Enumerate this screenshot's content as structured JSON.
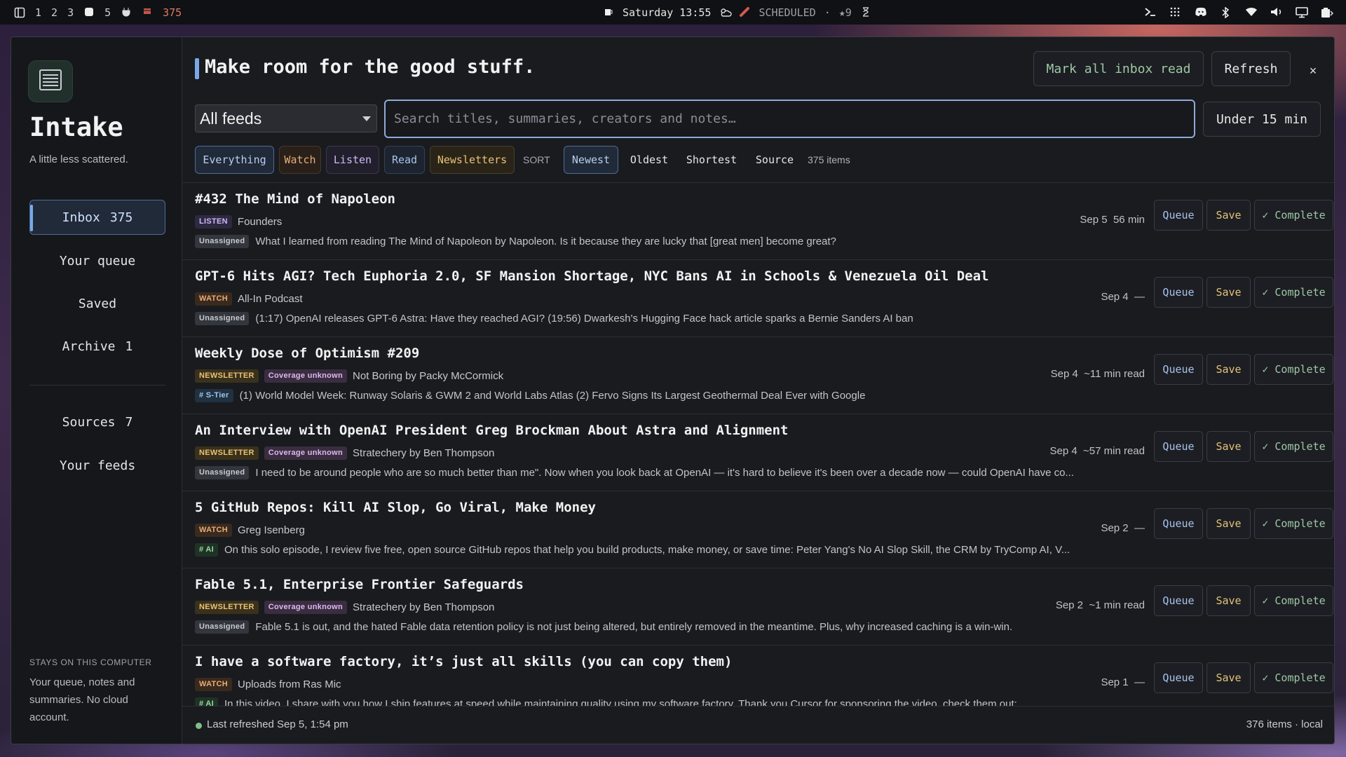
{
  "topbar": {
    "workspaces": [
      "1",
      "2",
      "3",
      "5"
    ],
    "counter_label": "375",
    "datetime": "Saturday 13:55",
    "scheduled_label": "SCHEDULED",
    "separator": "·",
    "stars": "★9"
  },
  "app": {
    "title": "Intake",
    "subtitle": "A little less scattered.",
    "headline": "Make room for the good stuff."
  },
  "sidebar": {
    "items": [
      {
        "label": "Inbox",
        "count": "375"
      },
      {
        "label": "Your queue",
        "count": ""
      },
      {
        "label": "Saved",
        "count": ""
      },
      {
        "label": "Archive",
        "count": "1"
      },
      {
        "label": "Sources",
        "count": "7"
      },
      {
        "label": "Your feeds",
        "count": ""
      }
    ],
    "footer_title": "STAYS ON THIS COMPUTER",
    "footer_text": "Your queue, notes and summaries. No cloud account."
  },
  "header": {
    "mark_all_label": "Mark all inbox read",
    "refresh_label": "Refresh",
    "close_label": "×",
    "feed_select_value": "All feeds",
    "search_placeholder": "Search titles, summaries, creators and notes…",
    "duration_filter": "Under 15 min"
  },
  "filters": {
    "chips": [
      "Everything",
      "Watch",
      "Listen",
      "Read",
      "Newsletters"
    ],
    "sort_label": "SORT",
    "sort_options": [
      "Newest",
      "Oldest",
      "Shortest",
      "Source"
    ],
    "item_count": "375 items"
  },
  "item_buttons": {
    "queue": "Queue",
    "save": "Save",
    "complete": "✓ Complete"
  },
  "items": [
    {
      "title": "#432 The Mind of Napoleon",
      "type": "LISTEN",
      "coverage": "",
      "source": "Founders",
      "tag": "Unassigned",
      "summary": "What I learned from reading The Mind of Napoleon by Napoleon. Is it because they are lucky that [great men] become great?",
      "date": "Sep 5",
      "duration": "56 min"
    },
    {
      "title": "GPT-6 Hits AGI? Tech Euphoria 2.0, SF Mansion Shortage, NYC Bans AI in Schools & Venezuela Oil Deal",
      "type": "WATCH",
      "coverage": "",
      "source": "All-In Podcast",
      "tag": "Unassigned",
      "summary": "(1:17) OpenAI releases GPT-6 Astra: Have they reached AGI? (19:56) Dwarkesh's Hugging Face hack article sparks a Bernie Sanders AI ban",
      "date": "Sep 4",
      "duration": "—"
    },
    {
      "title": "Weekly Dose of Optimism #209",
      "type": "NEWSLETTER",
      "coverage": "Coverage unknown",
      "source": "Not Boring by Packy McCormick",
      "tag": "# S-Tier",
      "summary": "(1) World Model Week: Runway Solaris & GWM 2 and World Labs Atlas (2) Fervo Signs Its Largest Geothermal Deal Ever with Google",
      "date": "Sep 4",
      "duration": "~11 min read"
    },
    {
      "title": "An Interview with OpenAI President Greg Brockman About Astra and Alignment",
      "type": "NEWSLETTER",
      "coverage": "Coverage unknown",
      "source": "Stratechery by Ben Thompson",
      "tag": "Unassigned",
      "summary": "I need to be around people who are so much better than me\". Now when you look back at OpenAI — it's hard to believe it's been over a decade now — could OpenAI have co...",
      "date": "Sep 4",
      "duration": "~57 min read"
    },
    {
      "title": "5 GitHub Repos: Kill AI Slop, Go Viral, Make Money",
      "type": "WATCH",
      "coverage": "",
      "source": "Greg Isenberg",
      "tag": "# AI",
      "summary": "On this solo episode, I review five free, open source GitHub repos that help you build products, make money, or save time: Peter Yang's No AI Slop Skill, the CRM by TryComp AI, V...",
      "date": "Sep 2",
      "duration": "—"
    },
    {
      "title": "Fable 5.1, Enterprise Frontier Safeguards",
      "type": "NEWSLETTER",
      "coverage": "Coverage unknown",
      "source": "Stratechery by Ben Thompson",
      "tag": "Unassigned",
      "summary": "Fable 5.1 is out, and the hated Fable data retention policy is not just being altered, but entirely removed in the meantime. Plus, why increased caching is a win-win.",
      "date": "Sep 2",
      "duration": "~1 min read"
    },
    {
      "title": "I have a software factory, it’s just all skills (you can copy them)",
      "type": "WATCH",
      "coverage": "",
      "source": "Uploads from Ras Mic",
      "tag": "# AI",
      "summary": "In this video, I share with you how I ship features at speed while maintaining quality using my software factory. Thank you Cursor for sponsoring the video, check them out:",
      "date": "Sep 1",
      "duration": "—"
    }
  ],
  "footer": {
    "last_refreshed": "Last refreshed Sep 5, 1:54 pm",
    "status": "376 items · local"
  },
  "colors": {
    "accent": "#7aa7e8",
    "queue": "#a9c3ea",
    "save": "#e5c17a",
    "complete": "#9fc7a6"
  }
}
